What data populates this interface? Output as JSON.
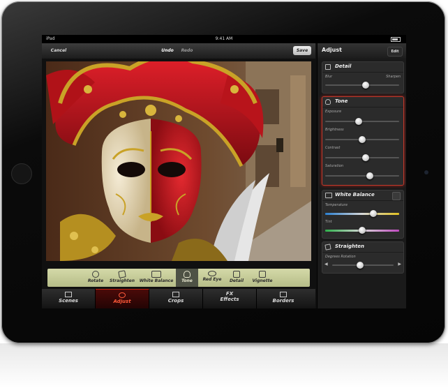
{
  "status": {
    "left": "iPad",
    "time": "9:41 AM"
  },
  "toolbar": {
    "cancel": "Cancel",
    "undo": "Undo",
    "redo": "Redo",
    "save": "Save"
  },
  "panel": {
    "title": "Adjust",
    "edit": "Edit",
    "detail": {
      "title": "Detail",
      "min_label": "Blur",
      "max_label": "Sharpen",
      "value": 0.55
    },
    "tone": {
      "title": "Tone",
      "sliders": [
        {
          "label": "Exposure",
          "value": 0.45
        },
        {
          "label": "Brightness",
          "value": 0.5
        },
        {
          "label": "Contrast",
          "value": 0.55
        },
        {
          "label": "Saturation",
          "value": 0.6
        }
      ]
    },
    "white_balance": {
      "title": "White Balance",
      "temperature": {
        "label": "Temperature",
        "value": 0.65
      },
      "tint": {
        "label": "Tint",
        "value": 0.5
      }
    },
    "straighten": {
      "title": "Straighten",
      "label": "Degrees Rotation",
      "value": 0.45
    }
  },
  "tools": [
    {
      "label": "Rotate",
      "icon": "rotate-icon",
      "selected": false
    },
    {
      "label": "Straighten",
      "icon": "straighten-icon",
      "selected": false
    },
    {
      "label": "White Balance",
      "icon": "white-balance-icon",
      "selected": false
    },
    {
      "label": "Tone",
      "icon": "tone-icon",
      "selected": true
    },
    {
      "label": "Red Eye",
      "icon": "red-eye-icon",
      "selected": false
    },
    {
      "label": "Detail",
      "icon": "detail-icon",
      "selected": false
    },
    {
      "label": "Vignette",
      "icon": "vignette-icon",
      "selected": false
    }
  ],
  "tabs": [
    {
      "label": "Scenes",
      "icon": "scenes-icon",
      "selected": false
    },
    {
      "label": "Adjust",
      "icon": "adjust-icon",
      "selected": true
    },
    {
      "label": "Crops",
      "icon": "crops-icon",
      "selected": false
    },
    {
      "label": "Effects",
      "icon": "effects-icon",
      "selected": false
    },
    {
      "label": "Borders",
      "icon": "borders-icon",
      "selected": false
    }
  ],
  "effects_prefix": "FX",
  "colors": {
    "accent": "#c0392b",
    "toolstrip": "#c8cf98",
    "mask_red": "#c0141a",
    "gold": "#c9a227"
  }
}
